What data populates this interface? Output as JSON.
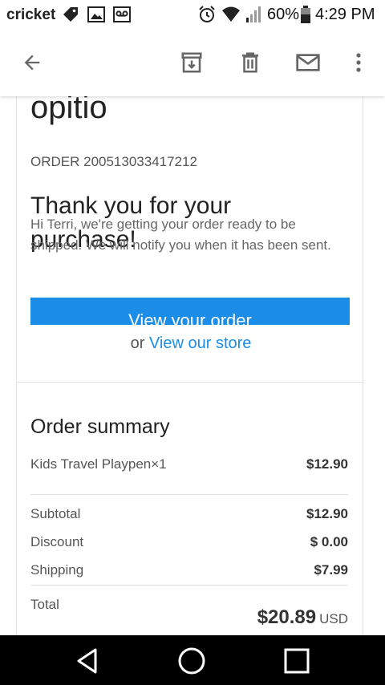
{
  "status_bar": {
    "carrier": "cricket",
    "battery": "60%",
    "time": "4:29 PM",
    "icons": [
      "signal-tag-icon",
      "image-icon",
      "voicemail-icon",
      "alarm-icon",
      "wifi-icon",
      "cell-signal-icon",
      "battery-icon"
    ]
  },
  "app_bar": {
    "actions": [
      "back-arrow-icon",
      "archive-icon",
      "delete-icon",
      "mark-unread-icon",
      "more-vert-icon"
    ]
  },
  "email": {
    "brand": "opitio",
    "order_number": "ORDER 200513033417212",
    "thanks_heading": "Thank you for your purchase!",
    "message": "Hi Terri, we're getting your order ready to be shipped. We will notify you when it has been sent.",
    "view_order_label": "View your order",
    "or_text": "or",
    "view_store_label": "View our store",
    "colors": {
      "accent": "#1b8de6"
    }
  },
  "summary": {
    "title": "Order summary",
    "items": [
      {
        "name": "Kids Travel Playpen×1",
        "price": "$12.90"
      }
    ],
    "rows": [
      {
        "label": "Subtotal",
        "value": "$12.90"
      },
      {
        "label": "Discount",
        "value": "$ 0.00"
      },
      {
        "label": "Shipping",
        "value": "$7.99"
      }
    ],
    "total_label": "Total",
    "total_value": "$20.89",
    "total_currency": "USD"
  },
  "nav_bar": {
    "buttons": [
      "back-triangle-icon",
      "home-circle-icon",
      "recents-square-icon"
    ]
  }
}
